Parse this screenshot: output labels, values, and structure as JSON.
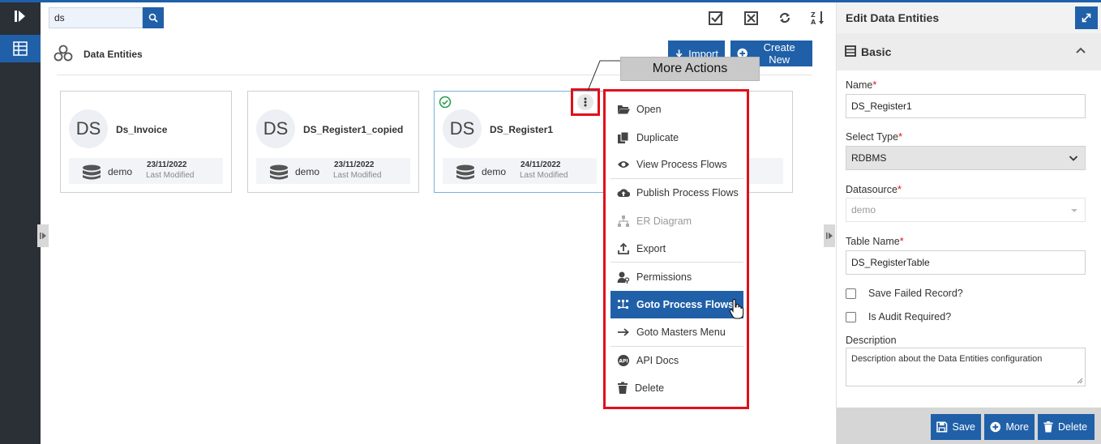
{
  "search": {
    "value": "ds"
  },
  "page": {
    "title": "Data Entities",
    "import_label": "Import",
    "create_label": "Create New"
  },
  "cards": [
    {
      "initials": "DS",
      "name": "Ds_Invoice",
      "datasource": "demo",
      "date": "23/11/2022",
      "modified_label": "Last Modified"
    },
    {
      "initials": "DS",
      "name": "DS_Register1_copied",
      "datasource": "demo",
      "date": "23/11/2022",
      "modified_label": "Last Modified"
    },
    {
      "initials": "DS",
      "name": "DS_Register1",
      "datasource": "demo",
      "date": "24/11/2022",
      "modified_label": "Last Modified"
    }
  ],
  "tooltip": "More Actions",
  "menu": {
    "items": [
      {
        "label": "Open"
      },
      {
        "label": "Duplicate"
      },
      {
        "label": "View Process Flows"
      },
      {
        "label": "Publish Process Flows"
      },
      {
        "label": "ER Diagram"
      },
      {
        "label": "Export"
      },
      {
        "label": "Permissions"
      },
      {
        "label": "Goto Process Flows"
      },
      {
        "label": "Goto Masters Menu"
      },
      {
        "label": "API Docs"
      },
      {
        "label": "Delete"
      }
    ]
  },
  "panel": {
    "title": "Edit Data Entities",
    "section": "Basic",
    "name_label": "Name",
    "name_value": "DS_Register1",
    "type_label": "Select Type",
    "type_value": "RDBMS",
    "datasource_label": "Datasource",
    "datasource_value": "demo",
    "table_label": "Table Name",
    "table_value": "DS_RegisterTable",
    "save_failed_label": "Save Failed Record?",
    "audit_label": "Is Audit Required?",
    "description_label": "Description",
    "description_value": "Description about the Data Entities configuration",
    "required_mark": "*",
    "save_label": "Save",
    "more_label": "More",
    "delete_label": "Delete"
  },
  "colors": {
    "primary": "#2060a8",
    "highlight_border": "#e0101a",
    "nav_bg": "#2b2f36"
  }
}
